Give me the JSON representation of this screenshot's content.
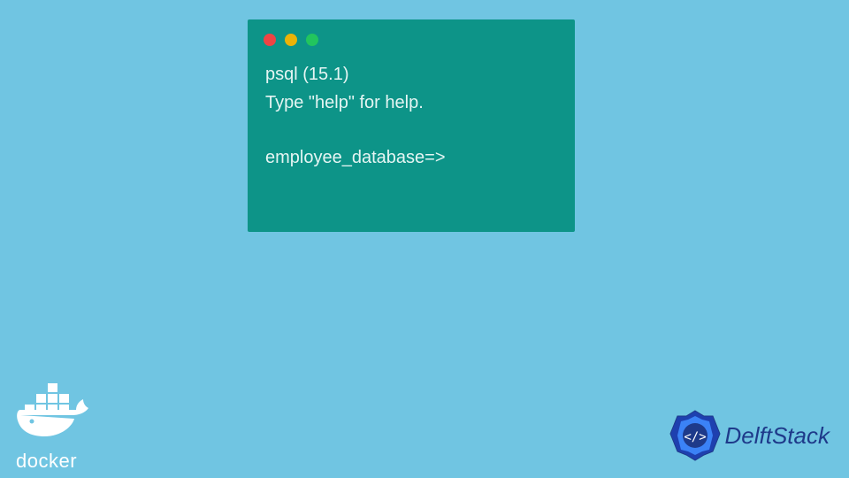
{
  "terminal": {
    "lines": [
      "psql (15.1)",
      "Type \"help\" for help."
    ],
    "prompt": "employee_database=>"
  },
  "logos": {
    "docker": "docker",
    "delftstack": "DelftStack"
  }
}
